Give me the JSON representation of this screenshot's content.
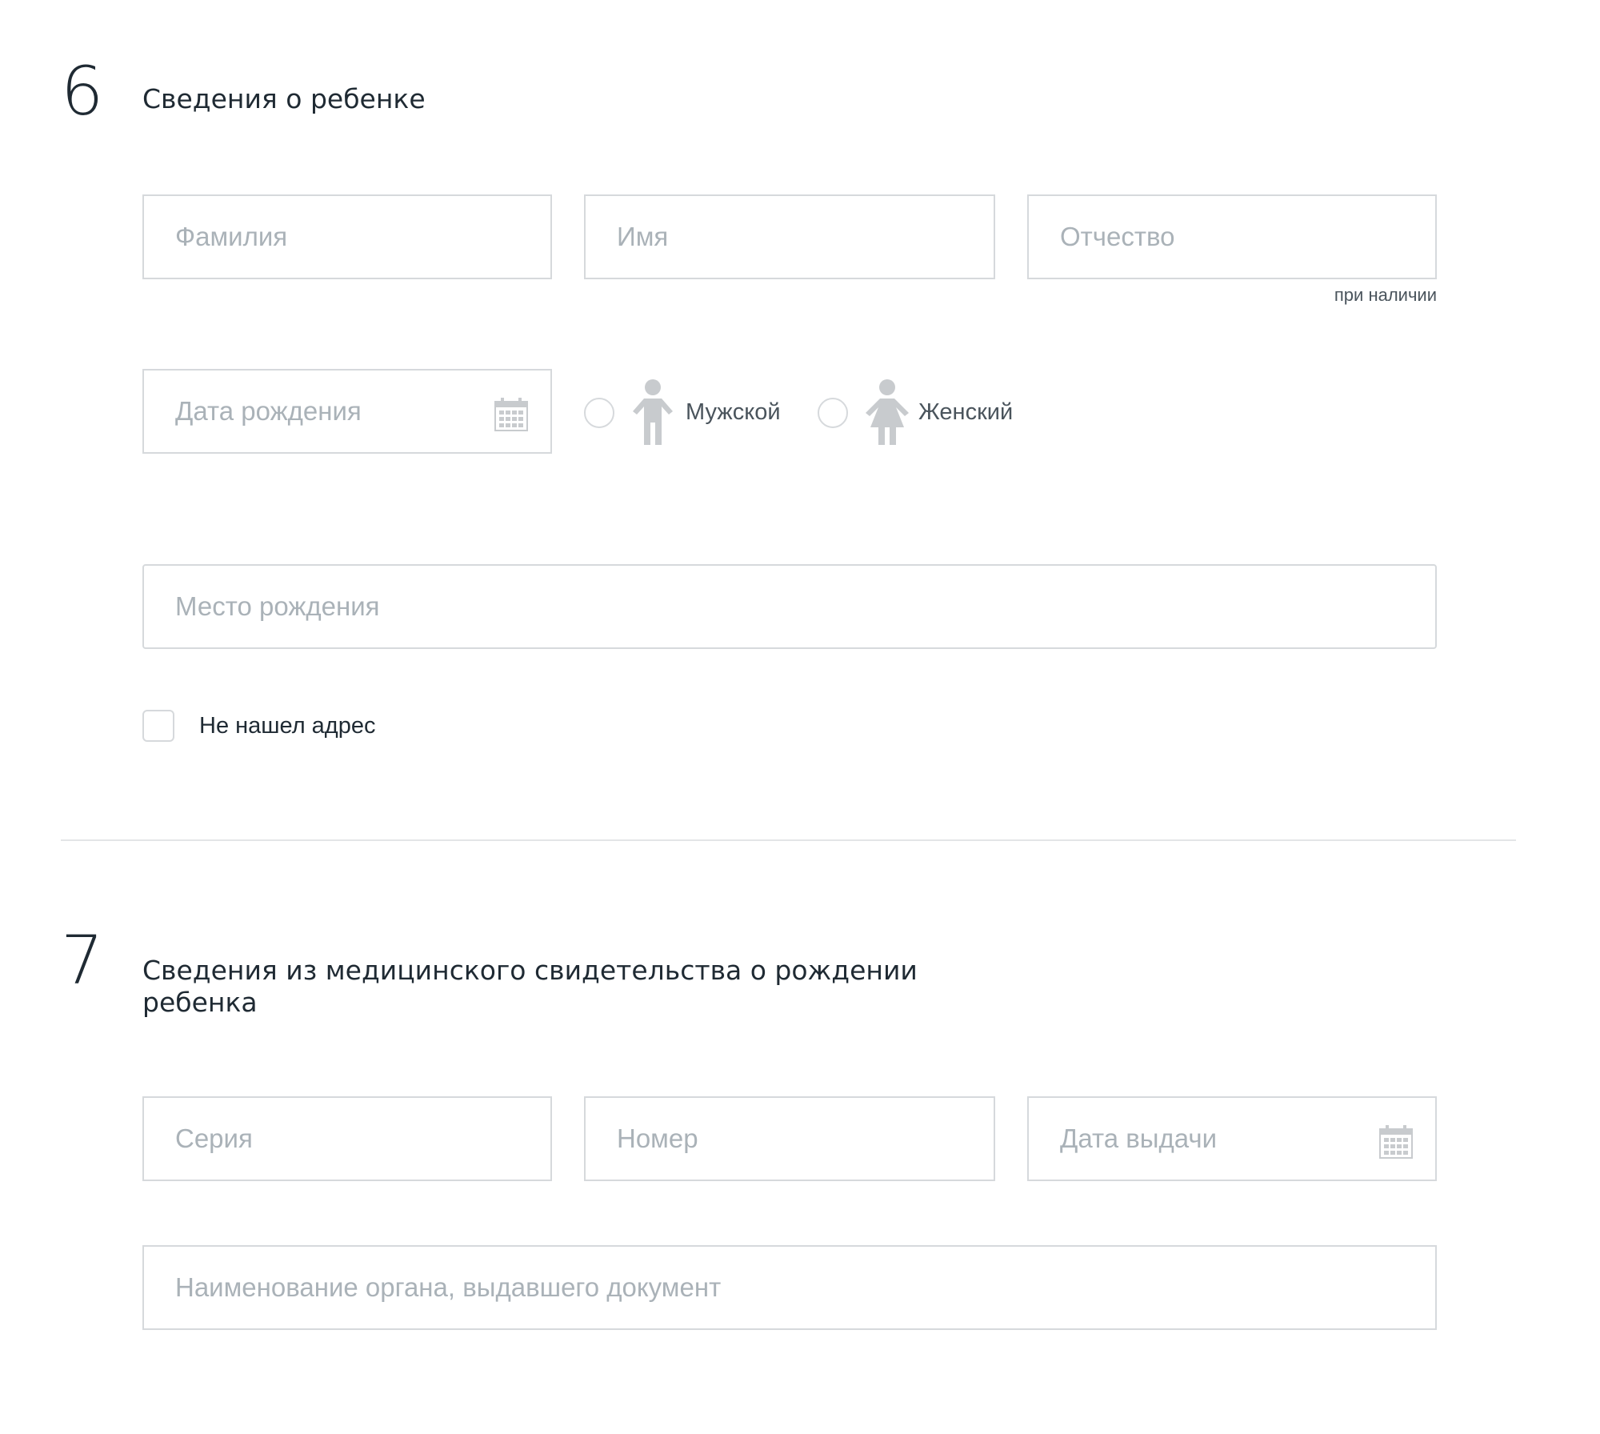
{
  "section6": {
    "number": "6",
    "title": "Сведения о ребенке",
    "fields": {
      "last_name_placeholder": "Фамилия",
      "first_name_placeholder": "Имя",
      "patronymic_placeholder": "Отчество",
      "patronymic_hint": "при наличии",
      "birth_date_placeholder": "Дата рождения",
      "birth_place_placeholder": "Место рождения"
    },
    "gender": {
      "male_label": "Мужской",
      "female_label": "Женский"
    },
    "address_not_found_label": "Не нашел адрес"
  },
  "section7": {
    "number": "7",
    "title": "Сведения из медицинского свидетельства о рождении ребенка",
    "fields": {
      "series_placeholder": "Серия",
      "number_placeholder": "Номер",
      "issue_date_placeholder": "Дата выдачи",
      "issuing_authority_placeholder": "Наименование органа, выдавшего документ"
    }
  },
  "icons": {
    "calendar": "calendar-icon",
    "male": "male-person-icon",
    "female": "female-person-icon"
  },
  "colors": {
    "border": "#d6d9dc",
    "placeholder": "#aab2b8",
    "icon": "#c8cbce",
    "text": "#1f2a33"
  }
}
